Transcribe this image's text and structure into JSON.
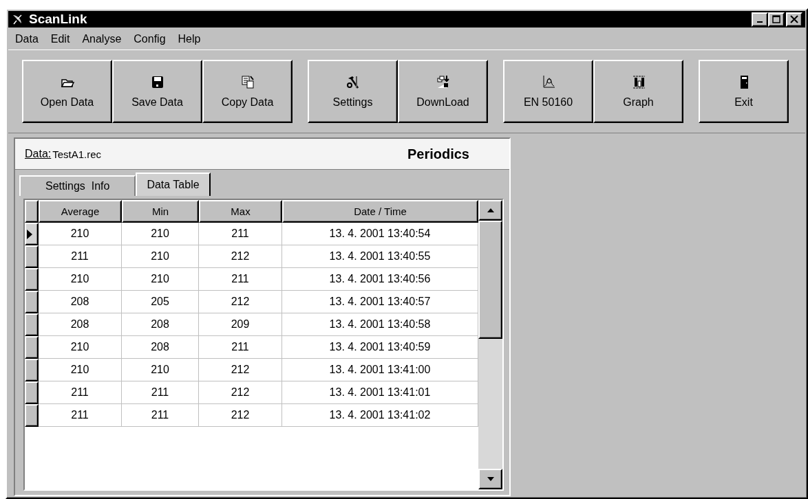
{
  "window": {
    "title": "ScanLink"
  },
  "menu": [
    "Data",
    "Edit",
    "Analyse",
    "Config",
    "Help"
  ],
  "toolbar": [
    [
      {
        "label": "Open Data"
      },
      {
        "label": "Save Data"
      },
      {
        "label": "Copy Data"
      }
    ],
    [
      {
        "label": "Settings"
      },
      {
        "label": "DownLoad"
      }
    ],
    [
      {
        "label": "EN 50160"
      },
      {
        "label": "Graph"
      }
    ],
    [
      {
        "label": "Exit"
      }
    ]
  ],
  "file_bar": {
    "label": "Data:",
    "file": "TestA1.rec",
    "mode": "Periodics"
  },
  "tabs": [
    {
      "label": "Settings  Info",
      "selected": false
    },
    {
      "label": "Data Table",
      "selected": true
    }
  ],
  "table": {
    "columns": [
      "Average",
      "Min",
      "Max",
      "Date / Time"
    ],
    "rows": [
      {
        "cells": [
          "210",
          "210",
          "211",
          "13. 4. 2001 13:40:54"
        ],
        "current": true
      },
      {
        "cells": [
          "211",
          "210",
          "212",
          "13. 4. 2001 13:40:55"
        ],
        "current": false
      },
      {
        "cells": [
          "210",
          "210",
          "211",
          "13. 4. 2001 13:40:56"
        ],
        "current": false
      },
      {
        "cells": [
          "208",
          "205",
          "212",
          "13. 4. 2001 13:40:57"
        ],
        "current": false
      },
      {
        "cells": [
          "208",
          "208",
          "209",
          "13. 4. 2001 13:40:58"
        ],
        "current": false
      },
      {
        "cells": [
          "210",
          "208",
          "211",
          "13. 4. 2001 13:40:59"
        ],
        "current": false
      },
      {
        "cells": [
          "210",
          "210",
          "212",
          "13. 4. 2001 13:41:00"
        ],
        "current": false
      },
      {
        "cells": [
          "211",
          "211",
          "212",
          "13. 4. 2001 13:41:01"
        ],
        "current": false
      },
      {
        "cells": [
          "211",
          "211",
          "212",
          "13. 4. 2001 13:41:02"
        ],
        "current": false
      }
    ]
  }
}
